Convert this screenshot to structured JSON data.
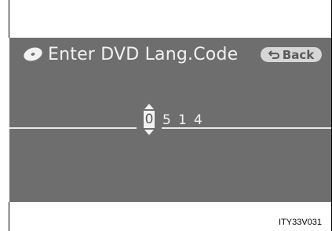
{
  "header": {
    "title": "Enter DVD  Lang.Code",
    "title_icon": "disc-icon"
  },
  "back_button": {
    "label": "Back",
    "icon": "return-arrow-icon"
  },
  "code_entry": {
    "selected_digit": "0",
    "other_digits": [
      "5",
      "1",
      "4"
    ],
    "up_icon": "arrow-up-icon",
    "down_icon": "arrow-down-icon"
  },
  "caption": "ITY33V031",
  "colors": {
    "screen_bg": "#6e6e6e",
    "text": "#f2f2f2",
    "button_bg": "#d6d6d6",
    "button_text": "#5a5a5a"
  }
}
